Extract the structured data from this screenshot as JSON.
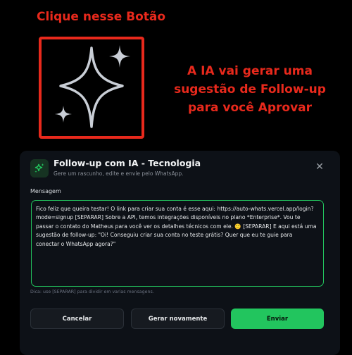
{
  "annotations": {
    "callout_title": "Clique nesse Botão",
    "callout_note": "A IA vai gerar uma sugestão de Follow-up para você Aprovar",
    "color": "#e8291c",
    "highlighted_icon": "sparkles-icon"
  },
  "modal": {
    "icon": "sparkles-icon",
    "title": "Follow-up com IA - Tecnologia",
    "subtitle": "Gere um rascunho, edite e envie pelo WhatsApp.",
    "close_icon": "close-icon",
    "field_label": "Mensagem",
    "message": "Fico feliz que queira testar! O link para criar sua conta é esse aqui: https://auto-whats.vercel.app/login?mode=signup [SEPARAR] Sobre a API, temos integrações disponíveis no plano *Enterprise*. Vou te passar o contato do Matheus para você ver os detalhes técnicos com ele. 🙂 [SEPARAR] E aqui está uma sugestão de follow-up: \"Oi! Conseguiu criar sua conta no teste grátis? Quer que eu te guie para conectar o WhatsApp agora?\"",
    "hint": "Dica: use [SEPARAR] para dividir em varias mensagens.",
    "buttons": {
      "cancel": "Cancelar",
      "regenerate": "Gerar novamente",
      "send": "Enviar"
    },
    "accent_color": "#22c55e"
  }
}
